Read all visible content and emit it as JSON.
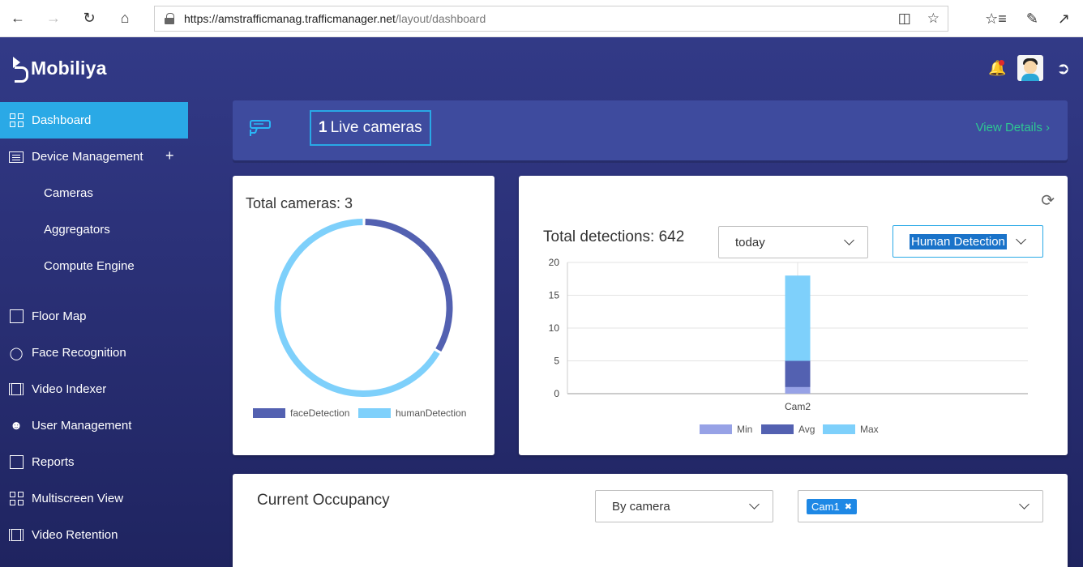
{
  "browser": {
    "url_host": "https://amstrafficmanag.trafficmanager.net",
    "url_path": "/layout/dashboard"
  },
  "app": {
    "brand": "Mobiliya"
  },
  "sidebar": {
    "items": [
      {
        "label": "Dashboard",
        "icon": "grid-icon",
        "active": true
      },
      {
        "label": "Device Management",
        "icon": "list-icon",
        "expand": "+"
      },
      {
        "label": "Cameras",
        "sub": true
      },
      {
        "label": "Aggregators",
        "sub": true
      },
      {
        "label": "Compute Engine",
        "sub": true
      },
      {
        "label": "Floor Map",
        "icon": "floor-map-icon"
      },
      {
        "label": "Face Recognition",
        "icon": "face-scan-icon"
      },
      {
        "label": "Video Indexer",
        "icon": "film-icon"
      },
      {
        "label": "User Management",
        "icon": "user-icon"
      },
      {
        "label": "Reports",
        "icon": "bar-chart-icon"
      },
      {
        "label": "Multiscreen View",
        "icon": "grid-icon"
      },
      {
        "label": "Video Retention",
        "icon": "film-icon"
      }
    ]
  },
  "banner": {
    "live_count": "1",
    "live_label": "Live cameras",
    "view_details": "View Details"
  },
  "cameras_card": {
    "title": "Total cameras: 3",
    "legend": [
      {
        "name": "faceDetection",
        "color": "#5361b1"
      },
      {
        "name": "humanDetection",
        "color": "#7ed0fb"
      }
    ]
  },
  "detections_card": {
    "title": "Total detections: 642",
    "period": "today",
    "detection_type": "Human Detection"
  },
  "occupancy": {
    "title": "Current Occupancy",
    "group_by": "By camera",
    "selected_camera": "Cam1"
  },
  "chart_data": [
    {
      "type": "pie",
      "title": "",
      "labels": [
        "faceDetection",
        "humanDetection"
      ],
      "values": [
        1,
        2
      ],
      "colors": [
        "#5361b1",
        "#7ed0fb"
      ],
      "style": "donut"
    },
    {
      "type": "bar",
      "stacked": true,
      "categories": [
        "Cam2"
      ],
      "series": [
        {
          "name": "Min",
          "values": [
            1
          ],
          "color": "#97a2e6"
        },
        {
          "name": "Avg",
          "values": [
            4
          ],
          "color": "#5361b1"
        },
        {
          "name": "Max",
          "values": [
            13
          ],
          "color": "#7ed0fb"
        }
      ],
      "ylim": [
        0,
        20
      ],
      "yticks": [
        0,
        5,
        10,
        15,
        20
      ],
      "grid": true,
      "legend": "bottom"
    }
  ]
}
